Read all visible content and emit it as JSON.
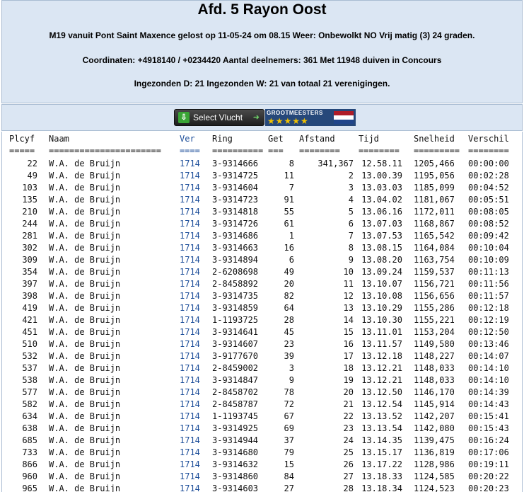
{
  "header": {
    "title": "Afd. 5 Rayon Oost",
    "line1": "M19 vanuit Pont Saint Maxence gelost op 11-05-24 om 08.15 Weer: Onbewolkt NO Vrij matig (3) 24 graden.",
    "line2": "Coordinaten: +4918140 / +0234420 Aantal deelnemers: 361 Met 11948 duiven in Concours",
    "line3": "Ingezonden D: 21 Ingezonden W: 21 van totaal 21 verenigingen."
  },
  "toolbar": {
    "select_label": "Select  Vlucht",
    "grootmeesters_label": "GROOTMEESTERS",
    "stars": "★★★★★",
    "flag_colors": [
      "#ae1c28",
      "#ffffff",
      "#21468b"
    ]
  },
  "table": {
    "columns": [
      "Plcyf",
      "Naam",
      "Ver",
      "Ring",
      "Get",
      "Afstand",
      "Tijd",
      "Snelheid",
      "Verschil"
    ],
    "underline": [
      "=====",
      "======================",
      "====",
      "==========",
      "===",
      "========",
      "========",
      "=========",
      "========"
    ],
    "rows": [
      [
        "22",
        "W.A. de Bruijn",
        "1714",
        "3-9314666",
        "8",
        "341,367",
        "12.58.11",
        "1205,466",
        "00:00:00"
      ],
      [
        "49",
        "W.A. de Bruijn",
        "1714",
        "3-9314725",
        "11",
        "2",
        "13.00.39",
        "1195,056",
        "00:02:28"
      ],
      [
        "103",
        "W.A. de Bruijn",
        "1714",
        "3-9314604",
        "7",
        "3",
        "13.03.03",
        "1185,099",
        "00:04:52"
      ],
      [
        "135",
        "W.A. de Bruijn",
        "1714",
        "3-9314723",
        "91",
        "4",
        "13.04.02",
        "1181,067",
        "00:05:51"
      ],
      [
        "210",
        "W.A. de Bruijn",
        "1714",
        "3-9314818",
        "55",
        "5",
        "13.06.16",
        "1172,011",
        "00:08:05"
      ],
      [
        "244",
        "W.A. de Bruijn",
        "1714",
        "3-9314726",
        "61",
        "6",
        "13.07.03",
        "1168,867",
        "00:08:52"
      ],
      [
        "281",
        "W.A. de Bruijn",
        "1714",
        "3-9314686",
        "1",
        "7",
        "13.07.53",
        "1165,542",
        "00:09:42"
      ],
      [
        "302",
        "W.A. de Bruijn",
        "1714",
        "3-9314663",
        "16",
        "8",
        "13.08.15",
        "1164,084",
        "00:10:04"
      ],
      [
        "309",
        "W.A. de Bruijn",
        "1714",
        "3-9314894",
        "6",
        "9",
        "13.08.20",
        "1163,754",
        "00:10:09"
      ],
      [
        "354",
        "W.A. de Bruijn",
        "1714",
        "2-6208698",
        "49",
        "10",
        "13.09.24",
        "1159,537",
        "00:11:13"
      ],
      [
        "397",
        "W.A. de Bruijn",
        "1714",
        "2-8458892",
        "20",
        "11",
        "13.10.07",
        "1156,721",
        "00:11:56"
      ],
      [
        "398",
        "W.A. de Bruijn",
        "1714",
        "3-9314735",
        "82",
        "12",
        "13.10.08",
        "1156,656",
        "00:11:57"
      ],
      [
        "419",
        "W.A. de Bruijn",
        "1714",
        "3-9314859",
        "64",
        "13",
        "13.10.29",
        "1155,286",
        "00:12:18"
      ],
      [
        "421",
        "W.A. de Bruijn",
        "1714",
        "1-1193725",
        "28",
        "14",
        "13.10.30",
        "1155,221",
        "00:12:19"
      ],
      [
        "451",
        "W.A. de Bruijn",
        "1714",
        "3-9314641",
        "45",
        "15",
        "13.11.01",
        "1153,204",
        "00:12:50"
      ],
      [
        "510",
        "W.A. de Bruijn",
        "1714",
        "3-9314607",
        "23",
        "16",
        "13.11.57",
        "1149,580",
        "00:13:46"
      ],
      [
        "532",
        "W.A. de Bruijn",
        "1714",
        "3-9177670",
        "39",
        "17",
        "13.12.18",
        "1148,227",
        "00:14:07"
      ],
      [
        "537",
        "W.A. de Bruijn",
        "1714",
        "2-8459002",
        "3",
        "18",
        "13.12.21",
        "1148,033",
        "00:14:10"
      ],
      [
        "538",
        "W.A. de Bruijn",
        "1714",
        "3-9314847",
        "9",
        "19",
        "13.12.21",
        "1148,033",
        "00:14:10"
      ],
      [
        "577",
        "W.A. de Bruijn",
        "1714",
        "2-8458702",
        "78",
        "20",
        "13.12.50",
        "1146,170",
        "00:14:39"
      ],
      [
        "582",
        "W.A. de Bruijn",
        "1714",
        "2-8458787",
        "72",
        "21",
        "13.12.54",
        "1145,914",
        "00:14:43"
      ],
      [
        "634",
        "W.A. de Bruijn",
        "1714",
        "1-1193745",
        "67",
        "22",
        "13.13.52",
        "1142,207",
        "00:15:41"
      ],
      [
        "638",
        "W.A. de Bruijn",
        "1714",
        "3-9314925",
        "69",
        "23",
        "13.13.54",
        "1142,080",
        "00:15:43"
      ],
      [
        "685",
        "W.A. de Bruijn",
        "1714",
        "3-9314944",
        "37",
        "24",
        "13.14.35",
        "1139,475",
        "00:16:24"
      ],
      [
        "733",
        "W.A. de Bruijn",
        "1714",
        "3-9314680",
        "79",
        "25",
        "13.15.17",
        "1136,819",
        "00:17:06"
      ],
      [
        "866",
        "W.A. de Bruijn",
        "1714",
        "3-9314632",
        "15",
        "26",
        "13.17.22",
        "1128,986",
        "00:19:11"
      ],
      [
        "960",
        "W.A. de Bruijn",
        "1714",
        "3-9314860",
        "84",
        "27",
        "13.18.33",
        "1124,585",
        "00:20:22"
      ],
      [
        "965",
        "W.A. de Bruijn",
        "1714",
        "3-9314603",
        "27",
        "28",
        "13.18.34",
        "1124,523",
        "00:20:23"
      ]
    ]
  }
}
